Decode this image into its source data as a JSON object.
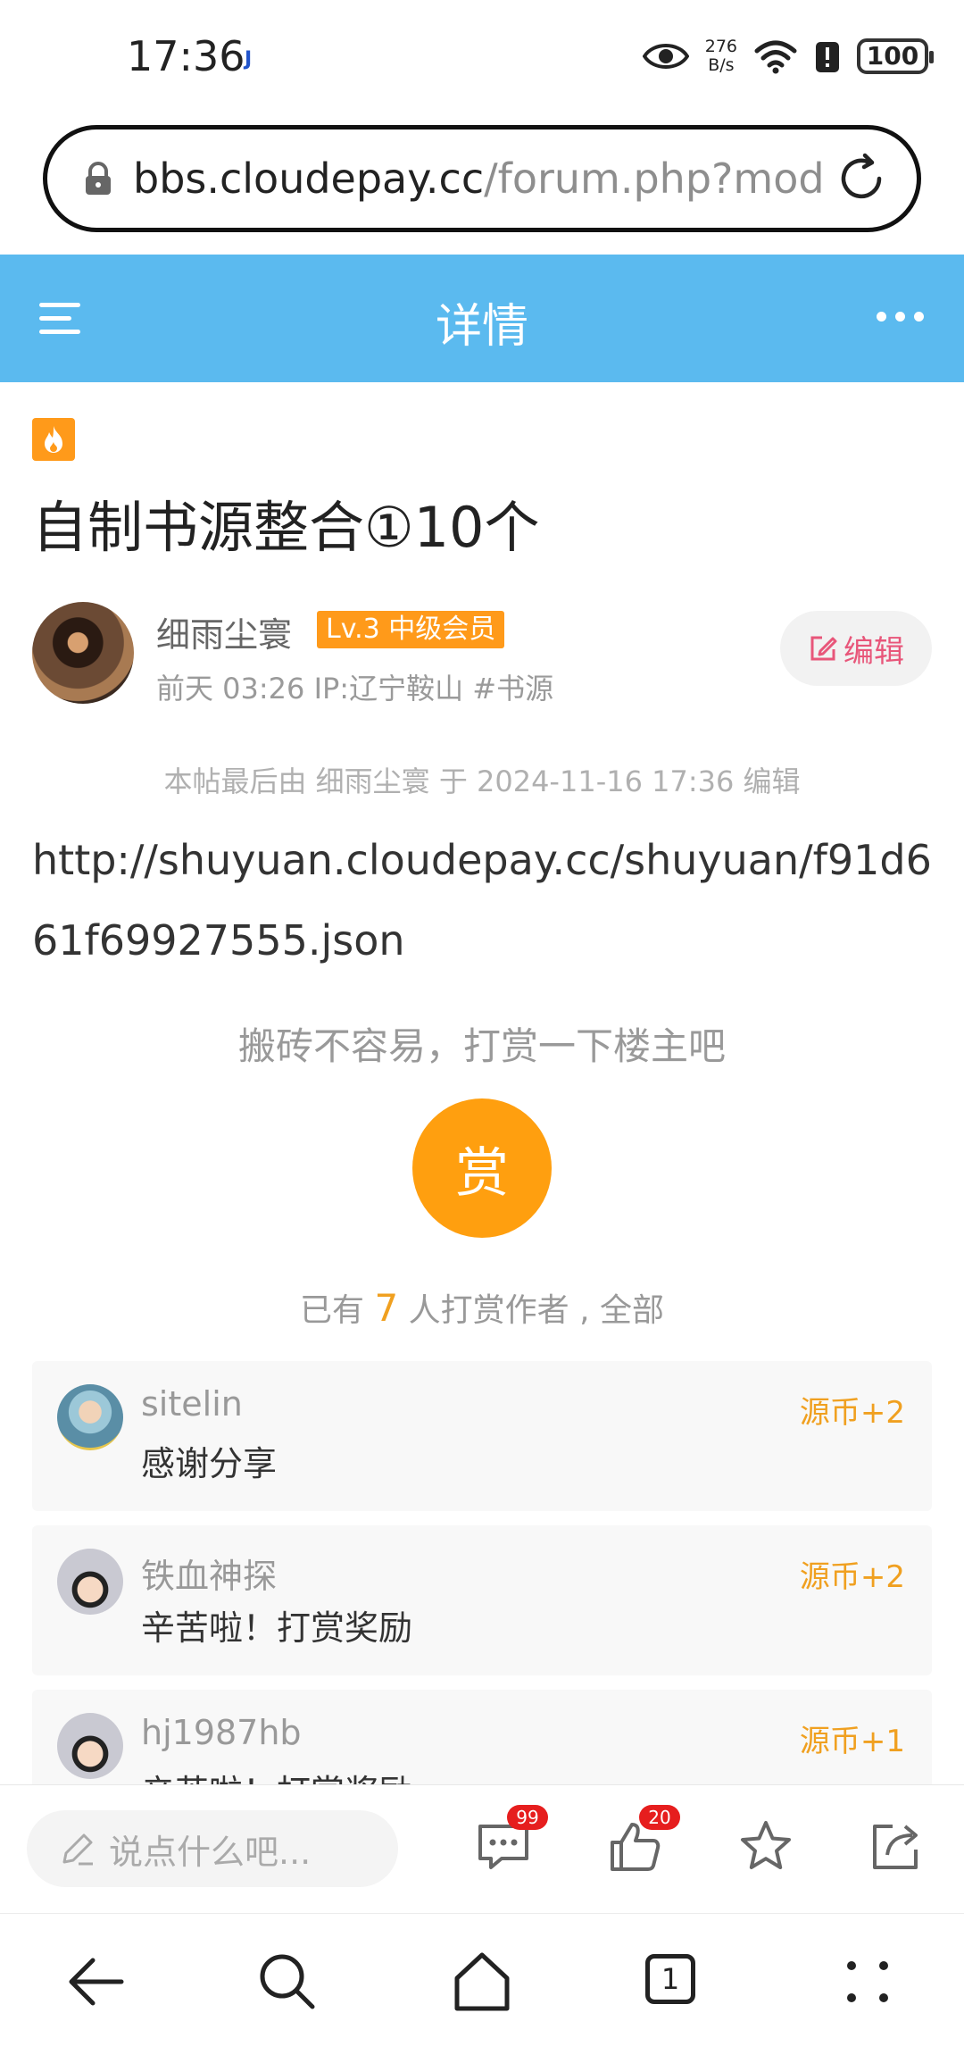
{
  "status_bar": {
    "time": "17:36",
    "app_indicator": "J",
    "net_speed_value": "276",
    "net_speed_unit": "B/s",
    "battery": "100"
  },
  "browser": {
    "url_host": "bbs.cloudepay.cc",
    "url_path": "/forum.php?mod"
  },
  "header": {
    "title": "详情"
  },
  "post": {
    "title": "自制书源整合①10个",
    "author": {
      "name": "细雨尘寰",
      "level": "Lv.3 中级会员",
      "meta": "前天 03:26  IP:辽宁鞍山 #书源"
    },
    "edit_label": "编辑",
    "edit_note": "本帖最后由 细雨尘寰 于 2024-11-16 17:36 编辑",
    "body": "http://shuyuan.cloudepay.cc/shuyuan/f91d661f69927555.json"
  },
  "reward": {
    "prompt": "搬砖不容易，打赏一下楼主吧",
    "button_label": "赏",
    "count_prefix": "已有 ",
    "count": "7",
    "count_suffix": " 人打赏作者 , 全部",
    "items": [
      {
        "name": "sitelin",
        "reward": "源币+2",
        "message": "感谢分享"
      },
      {
        "name": "铁血神探",
        "reward": "源币+2",
        "message": "辛苦啦！打赏奖励"
      },
      {
        "name": "hj1987hb",
        "reward": "源币+1",
        "message": "辛苦啦！打赏奖励"
      }
    ]
  },
  "comment_bar": {
    "placeholder": "说点什么吧...",
    "comment_count": "99",
    "like_count": "20"
  },
  "nav": {
    "tab_count": "1"
  }
}
